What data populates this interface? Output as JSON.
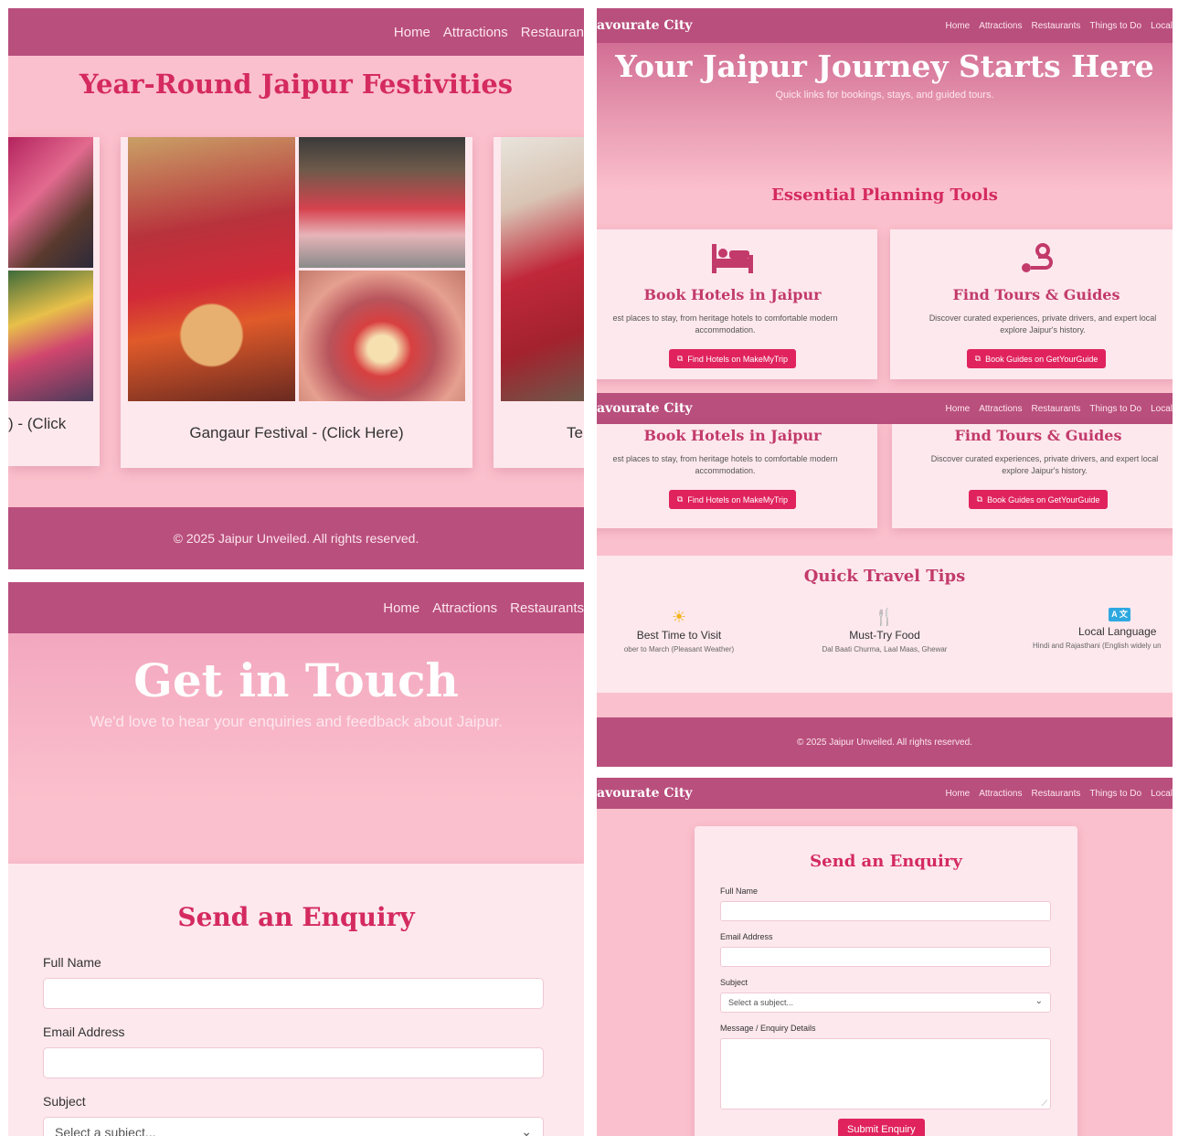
{
  "nav": {
    "home": "Home",
    "attractions": "Attractions",
    "restaurants": "Restaurants",
    "things_to_do": "Things to Do",
    "local": "Local",
    "restaur_cut": "Restauran",
    "brand_cut": "avourate City"
  },
  "festivities": {
    "title": "Year-Round Jaipur Festivities",
    "left_caption": ") - (Click",
    "main_caption": "Gangaur Festival - (Click Here)",
    "right_caption": "Te"
  },
  "footer": {
    "text": "© 2025 Jaipur Unveiled. All rights reserved."
  },
  "planning": {
    "hero_title": "Your Jaipur Journey Starts Here",
    "hero_subtitle": "Quick links for bookings, stays, and guided tours.",
    "section_title": "Essential Planning Tools",
    "hotels": {
      "title": "Book Hotels in Jaipur",
      "desc": "est places to stay, from heritage hotels to comfortable modern accommodation.",
      "button": "Find Hotels on MakeMyTrip"
    },
    "tours": {
      "title": "Find Tours & Guides",
      "desc": "Discover curated experiences, private drivers, and expert local explore Jaipur's history.",
      "button": "Book Guides on GetYourGuide"
    },
    "tips_title": "Quick Travel Tips",
    "tips": [
      {
        "name": "Best Time to Visit",
        "detail": "ober to March (Pleasant Weather)",
        "icon": "sun-icon"
      },
      {
        "name": "Must-Try Food",
        "detail": "Dal Baati Churma, Laal Maas, Ghewar",
        "icon": "utensils-icon"
      },
      {
        "name": "Local Language",
        "detail": "Hindi and Rajasthani (English widely un",
        "icon": "language-icon"
      }
    ]
  },
  "contact": {
    "title": "Get in Touch",
    "subtitle": "We'd love to hear your enquiries and feedback about Jaipur.",
    "form_title": "Send an Enquiry",
    "full_name": "Full Name",
    "email": "Email Address",
    "subject": "Subject",
    "subject_placeholder": "Select a subject...",
    "message": "Message / Enquiry Details",
    "submit": "Submit Enquiry"
  },
  "colors": {
    "nav": "#b94f7d",
    "accent": "#e0235d",
    "heading": "#d42a5f",
    "background": "#fbc0cd"
  }
}
